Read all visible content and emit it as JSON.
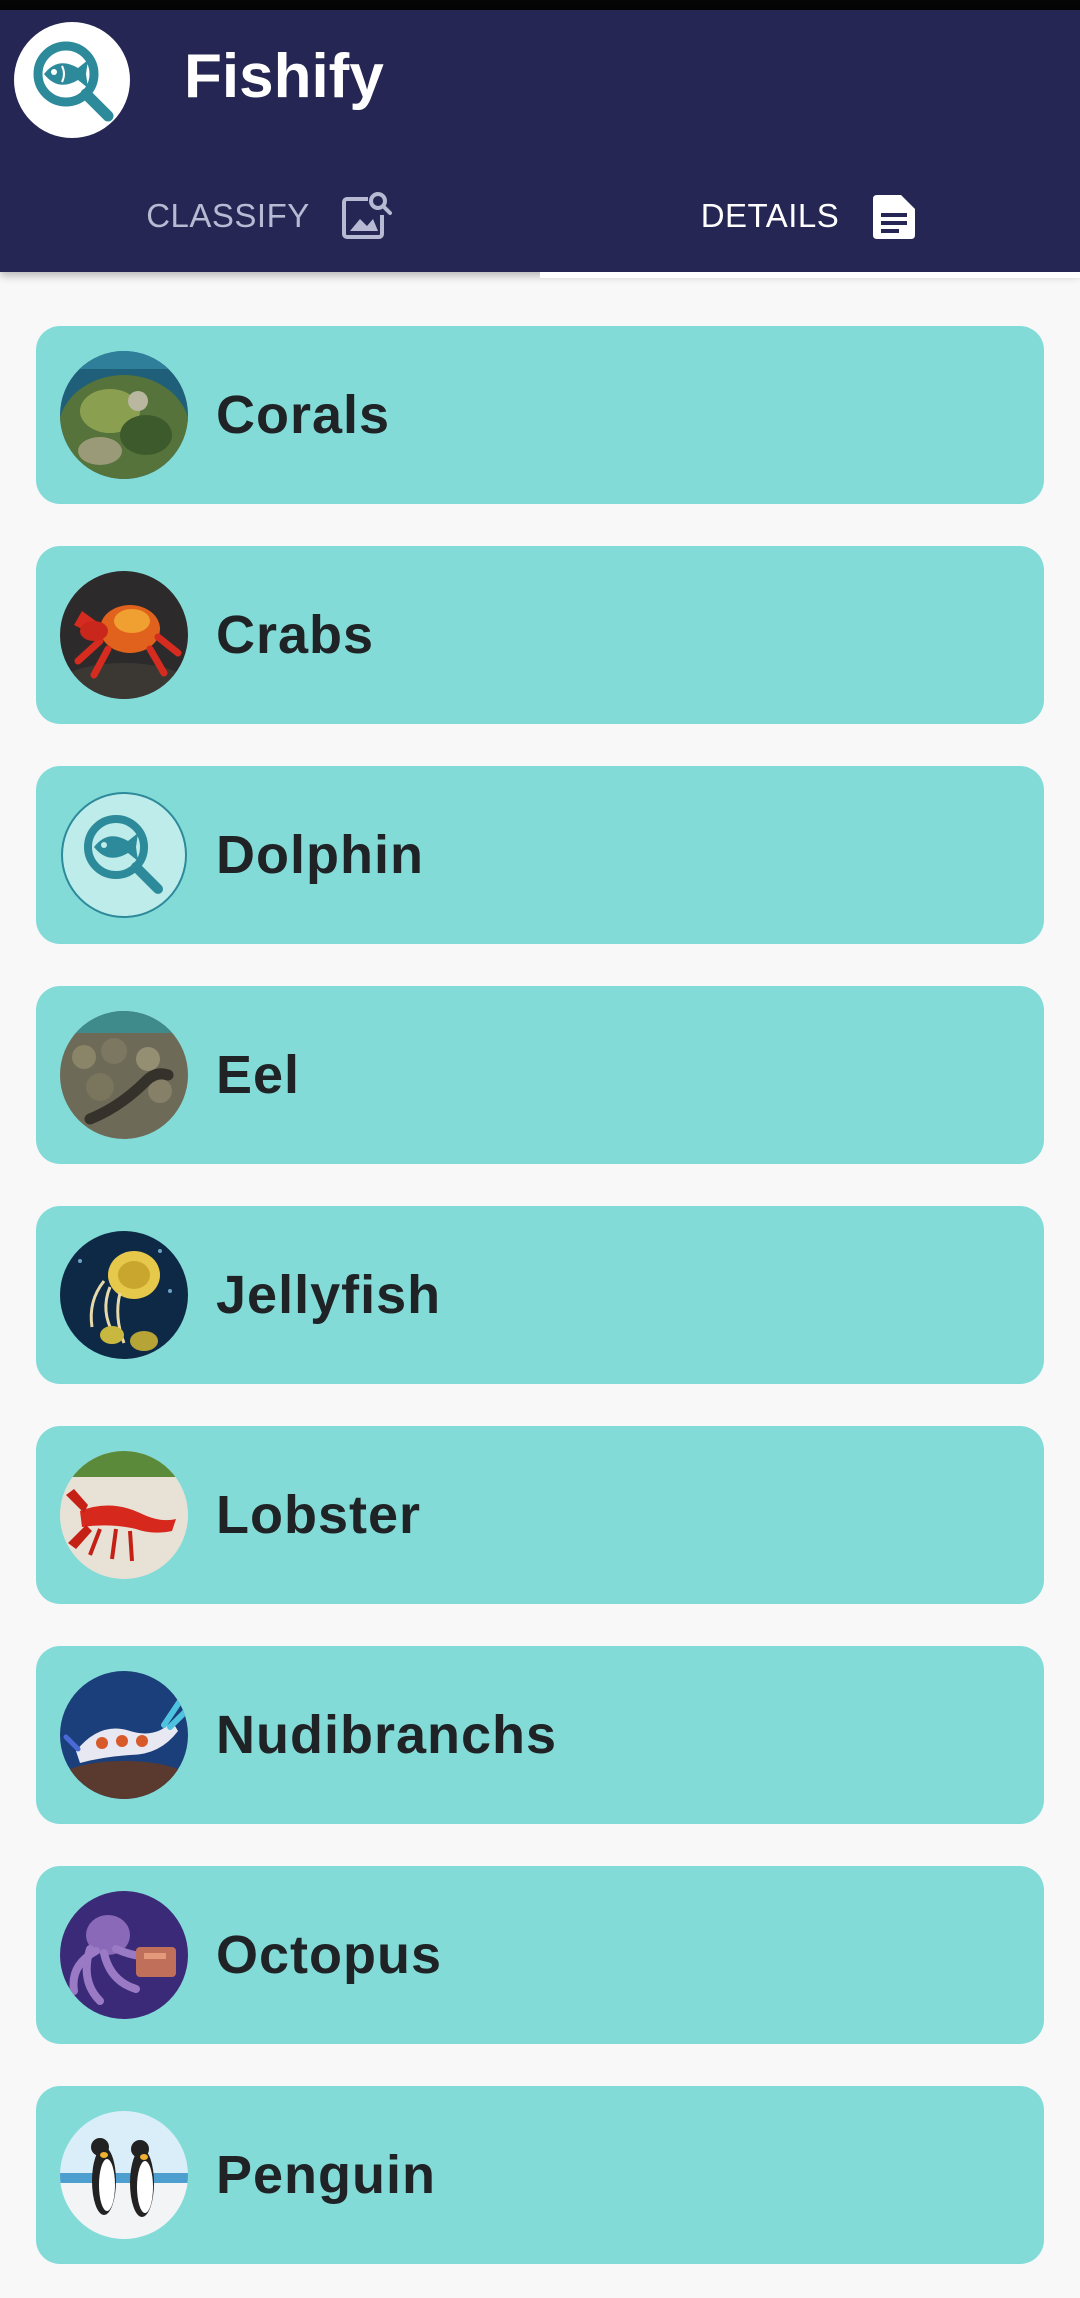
{
  "app": {
    "title": "Fishify",
    "logo_icon": "fish-magnifier-icon",
    "colors": {
      "appbar": "#252653",
      "card": "#83dbd8",
      "accent": "#2d8a9a"
    }
  },
  "tabs": [
    {
      "label": "CLASSIFY",
      "icon": "image-search-icon",
      "active": false
    },
    {
      "label": "DETAILS",
      "icon": "document-icon",
      "active": true
    }
  ],
  "species": [
    {
      "label": "Corals",
      "thumb": "corals-photo"
    },
    {
      "label": "Crabs",
      "thumb": "crab-photo"
    },
    {
      "label": "Dolphin",
      "thumb": "fish-magnifier-icon"
    },
    {
      "label": "Eel",
      "thumb": "eel-photo"
    },
    {
      "label": "Jellyfish",
      "thumb": "jellyfish-photo"
    },
    {
      "label": "Lobster",
      "thumb": "lobster-photo"
    },
    {
      "label": "Nudibranchs",
      "thumb": "nudibranch-photo"
    },
    {
      "label": "Octopus",
      "thumb": "octopus-photo"
    },
    {
      "label": "Penguin",
      "thumb": "penguin-photo"
    }
  ]
}
